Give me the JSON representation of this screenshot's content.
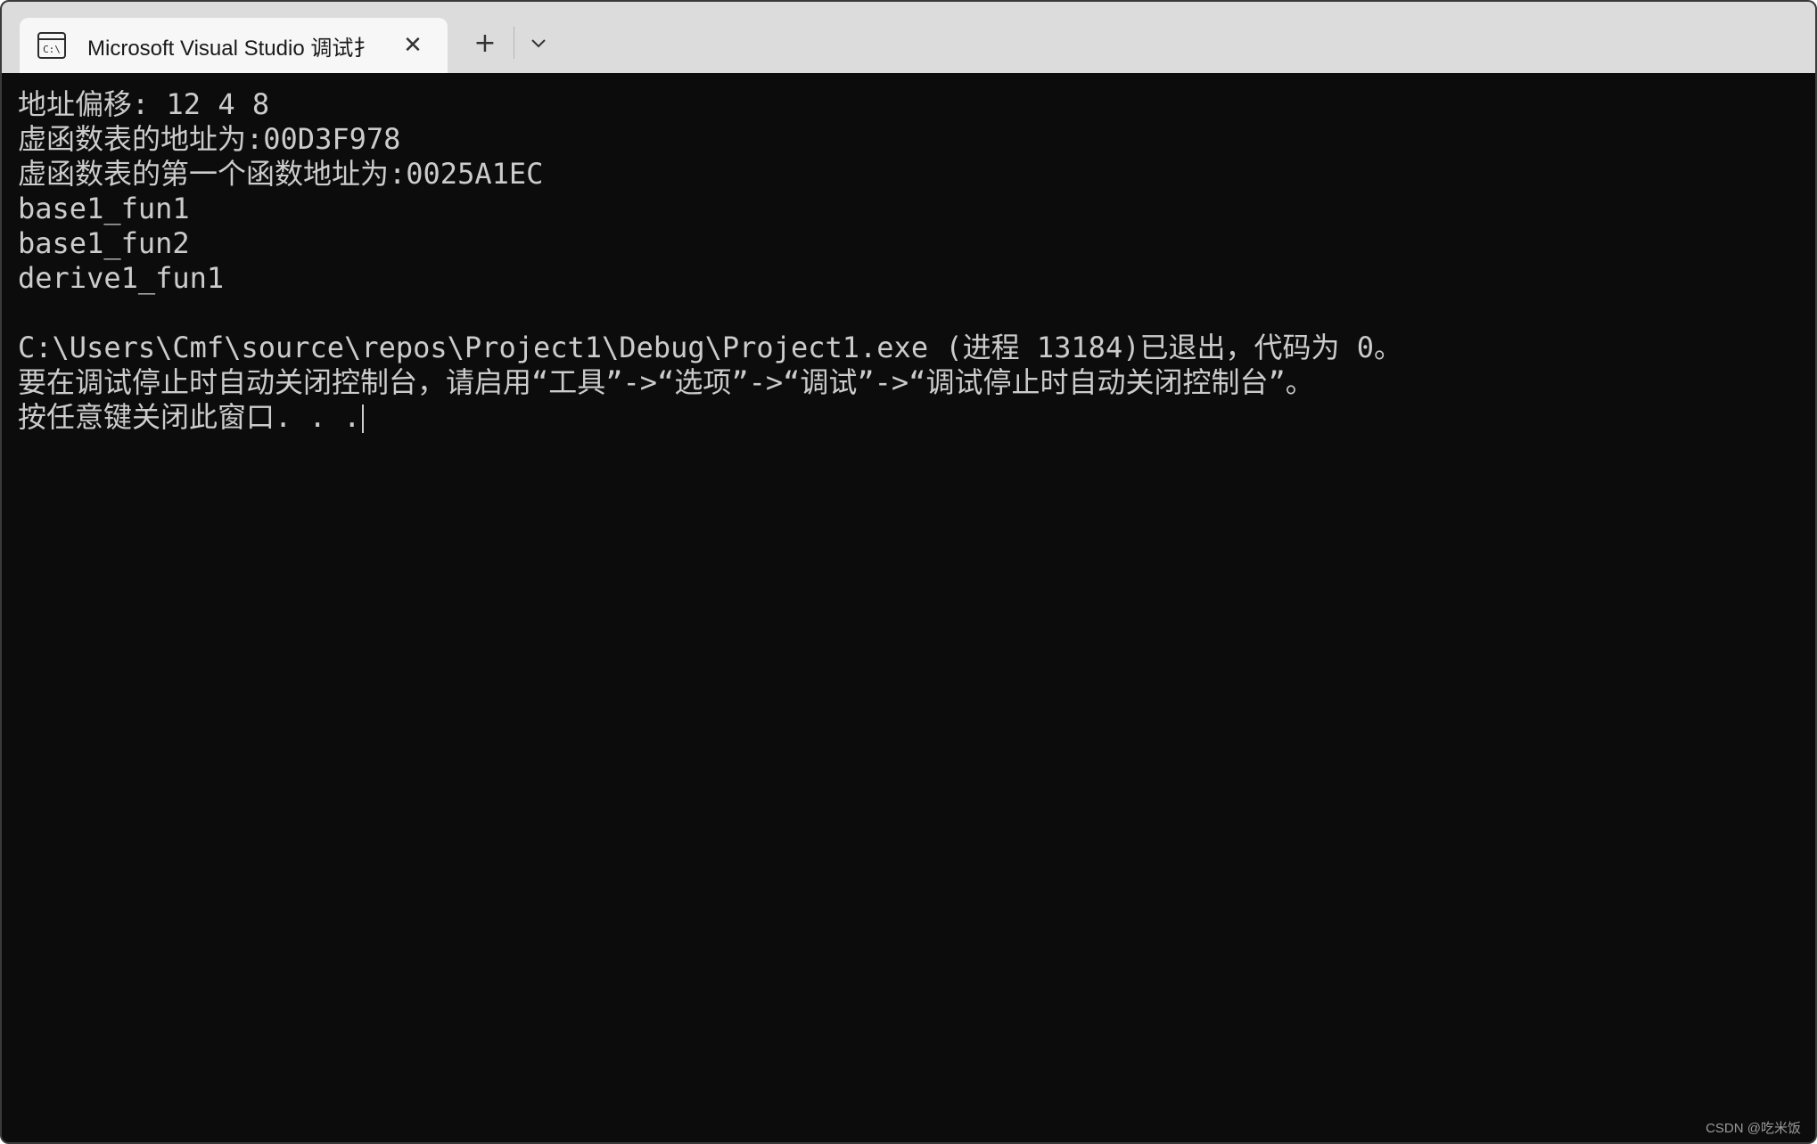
{
  "tab": {
    "title": "Microsoft Visual Studio 调试扌",
    "icon": "console-icon",
    "icon_label": "C:\\",
    "close_icon": "close-icon"
  },
  "toolbar": {
    "new_tab_label": "+",
    "dropdown_icon": "chevron-down-icon"
  },
  "console": {
    "lines": [
      "地址偏移: 12 4 8",
      "虚函数表的地址为:00D3F978",
      "虚函数表的第一个函数地址为:0025A1EC",
      "base1_fun1",
      "base1_fun2",
      "derive1_fun1",
      "",
      "C:\\Users\\Cmf\\source\\repos\\Project1\\Debug\\Project1.exe (进程 13184)已退出，代码为 0。",
      "要在调试停止时自动关闭控制台，请启用“工具”->“选项”->“调试”->“调试停止时自动关闭控制台”。",
      "按任意键关闭此窗口. . ."
    ]
  },
  "watermark": "CSDN @吃米饭",
  "colors": {
    "console_bg": "#0c0c0c",
    "console_fg": "#cccccc",
    "titlebar_bg": "#dcdcdc",
    "tab_bg": "#f7f7f7"
  }
}
